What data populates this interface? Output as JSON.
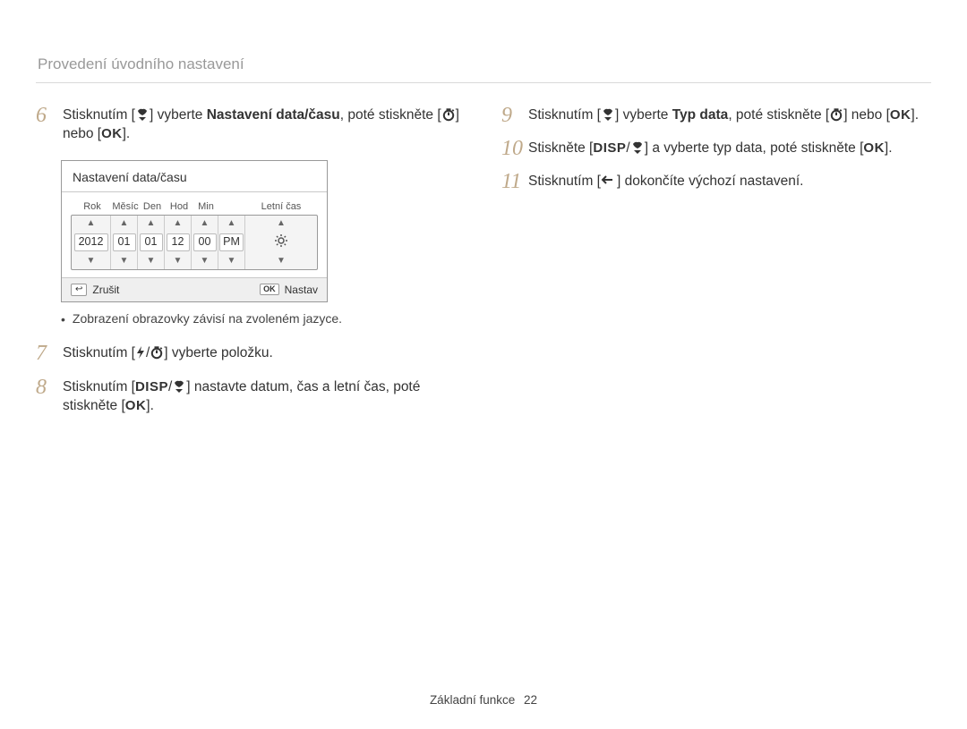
{
  "header": "Provedení úvodního nastavení",
  "steps": {
    "s6": {
      "num": "6",
      "pre": "Stisknutím [",
      "mid1": "] vyberte ",
      "bold": "Nastavení data/času",
      "mid2": ", poté stiskněte [",
      "mid3": "] nebo [",
      "post": "]."
    },
    "s7": {
      "num": "7",
      "pre": "Stisknutím [",
      "mid": "] vyberte položku.",
      "sep": "/"
    },
    "s8": {
      "num": "8",
      "pre": "Stisknutím [",
      "sep": "/",
      "mid": "] nastavte datum, čas a letní čas, poté stiskněte [",
      "post": "]."
    },
    "s9": {
      "num": "9",
      "pre": "Stisknutím [",
      "mid1": "] vyberte ",
      "bold": "Typ data",
      "mid2": ", poté stiskněte [",
      "mid3": "] nebo [",
      "post": "]."
    },
    "s10": {
      "num": "10",
      "pre": "Stiskněte [",
      "sep": "/",
      "mid": "] a vyberte typ data, poté stiskněte [",
      "post": "]."
    },
    "s11": {
      "num": "11",
      "pre": "Stisknutím [",
      "post": "] dokončíte výchozí nastavení."
    }
  },
  "note": "Zobrazení obrazovky závisí na zvoleném jazyce.",
  "device": {
    "title": "Nastavení data/času",
    "labels": {
      "rok": "Rok",
      "mesic": "Měsíc",
      "den": "Den",
      "hod": "Hod",
      "min": "Min",
      "letni": "Letní čas"
    },
    "values": {
      "rok": "2012",
      "mesic": "01",
      "den": "01",
      "hod": "12",
      "min": "00",
      "ampm": "PM"
    },
    "footer": {
      "zrusit": "Zrušit",
      "nastav": "Nastav"
    }
  },
  "footer": {
    "section": "Základní funkce",
    "page": "22"
  },
  "glyph": {
    "ok": "OK",
    "disp": "DISP"
  }
}
